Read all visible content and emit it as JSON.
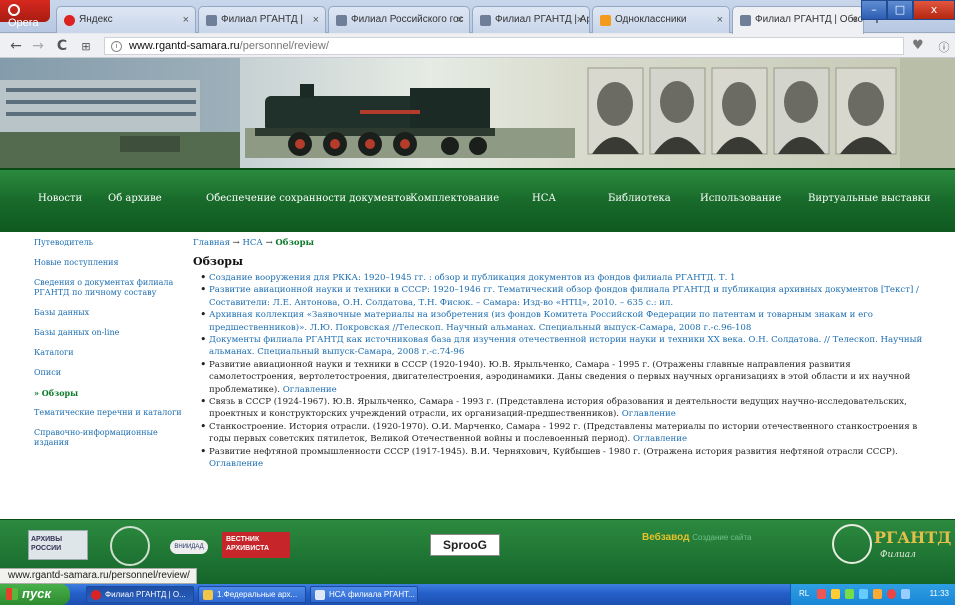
{
  "browser": {
    "opera_label": "Opera",
    "tabs": [
      {
        "title": "Яндекс",
        "close": "×"
      },
      {
        "title": "Филиал РГАНТД |",
        "close": "×"
      },
      {
        "title": "Филиал Российского гос",
        "close": "×"
      },
      {
        "title": "Филиал РГАНТД | Архи",
        "close": "×"
      },
      {
        "title": "Одноклассники",
        "close": "×"
      },
      {
        "title": "Филиал РГАНТД | Обзо",
        "close": "×"
      }
    ],
    "new_tab": "+",
    "url_host": "www.rgantd-samara.ru",
    "url_path": "/personnel/review/",
    "win_min": "–",
    "win_max": "□",
    "win_close": "x"
  },
  "nav": {
    "items": [
      "Новости",
      "Об архиве",
      "Обеспечение сохранности документов",
      "Комплектование",
      "НСА",
      "Библиотека",
      "Использование",
      "Виртуальные выставки"
    ]
  },
  "sidebar": {
    "items": [
      "Путеводитель",
      "Новые поступления",
      "Сведения о документах филиала РГАНТД по личному составу",
      "Базы данных",
      "Базы данных on-line",
      "Каталоги",
      "Описи",
      "» Обзоры",
      "Тематические перечни и каталоги",
      "Справочно-информационные издания"
    ]
  },
  "breadcrumb": {
    "home": "Главная",
    "sep1": " → ",
    "nsa": "НСА",
    "sep2": " → ",
    "current": "Обзоры"
  },
  "main": {
    "title": "Обзоры",
    "items": [
      {
        "link": "Создание вооружения для РККА: 1920–1945 гг. : обзор и публикация документов из фондов филиала РГАНТД. Т. 1",
        "text": "",
        "toc": ""
      },
      {
        "link": "Развитие авиационной науки и техники в СССР: 1920–1946 гг. Тематический обзор фондов филиала РГАНТД и публикация архивных документов [Текст] / Составители: Л.Е. Антонова, О.Н. Солдатова, Т.Н. Фисюк. – Самара: Изд-во «НТЦ», 2010. – 635 с.: ил.",
        "text": "",
        "toc": ""
      },
      {
        "link": "Архивная коллекция «Заявочные материалы на изобретения (из фондов Комитета Российской Федерации по патентам и товарным знакам и его предшественников)». Л.Ю. Покровская //Телескоп. Научный альманах. Специальный выпуск-Самара, 2008 г.-с.96-108",
        "text": "",
        "toc": ""
      },
      {
        "link": "Документы филиала РГАНТД как источниковая база для изучения отечественной истории науки и техники XX века. О.Н. Солдатова. // Телескоп. Научный альманах. Специальный выпуск-Самара, 2008 г.-с.74-96",
        "text": "",
        "toc": ""
      },
      {
        "link": "",
        "text": "Развитие авиационной науки и техники в СССР (1920-1940). Ю.В. Ярыльченко, Самара - 1995 г. (Отражены главные направления развития самолетостроения, вертолетостроения, двигателестроения, аэродинамики. Даны сведения о первых научных организациях в этой области и их научной проблематике).",
        "toc": "Оглавление"
      },
      {
        "link": "",
        "text": "Связь в СССР (1924-1967). Ю.В. Ярыльченко, Самара - 1993 г. (Представлена история образования и деятельности ведущих научно-исследовательских, проектных и конструкторских учреждений отрасли, их организаций-предшественников).",
        "toc": "Оглавление"
      },
      {
        "link": "",
        "text": "Станкостроение. История отрасли. (1920-1970). О.И. Марченко, Самара - 1992 г. (Представлены материалы по истории отечественного станкостроения в годы первых советских пятилеток, Великой Отечественной войны и послевоенный период).",
        "toc": "Оглавление"
      },
      {
        "link": "",
        "text": "Развитие нефтяной промышленности СССР (1917-1945). В.И. Черняхович, Куйбышев - 1980 г. (Отражена история развития нефтяной отрасли СССР).",
        "toc": "Оглавление"
      }
    ]
  },
  "footer": {
    "logo_archives": "АРХИВЫ РОССИИ",
    "logo_vniidad": "ВНИИДАД",
    "logo_vestnik": "ВЕСТНИК АРХИВИСТА",
    "logo_sprog": "SprooG",
    "webzavod": "Вебзавод",
    "webzavod_sub": "Создание сайта",
    "rgantd": "РГАНТД",
    "filial": "Филиал"
  },
  "status_url": "www.rgantd-samara.ru/personnel/review/",
  "taskbar": {
    "start": "пуск",
    "tasks": [
      "Филиал РГАНТД | О...",
      "1.Федеральные арх...",
      "НСА филиала РГАНТ..."
    ],
    "lang": "RL",
    "clock": "11:33"
  },
  "colors": {
    "nav_green": "#186a2a",
    "link_blue": "#1a6cb0",
    "current_green": "#0c7a2b"
  }
}
